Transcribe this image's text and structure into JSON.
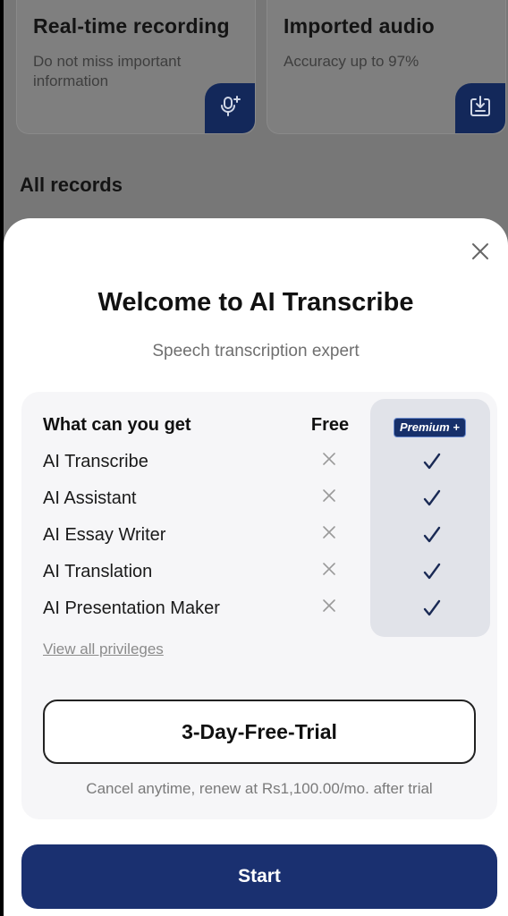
{
  "background": {
    "cards": [
      {
        "title": "Real-time recording",
        "subtitle": "Do not miss important information",
        "icon": "microphone-add-icon"
      },
      {
        "title": "Imported audio",
        "subtitle": "Accuracy up to 97%",
        "icon": "import-icon"
      }
    ],
    "records_title": "All records"
  },
  "sheet": {
    "title": "Welcome to AI Transcribe",
    "subtitle": "Speech transcription expert",
    "table": {
      "header_feature": "What can you get",
      "header_free": "Free",
      "header_premium": "Premium +",
      "rows": [
        {
          "feature": "AI Transcribe",
          "free": "cross-icon",
          "premium": "check-icon"
        },
        {
          "feature": "AI Assistant",
          "free": "cross-icon",
          "premium": "check-icon"
        },
        {
          "feature": "AI Essay Writer",
          "free": "cross-icon",
          "premium": "check-icon"
        },
        {
          "feature": "AI Translation",
          "free": "cross-icon",
          "premium": "check-icon"
        },
        {
          "feature": "AI Presentation Maker",
          "free": "cross-icon",
          "premium": "check-icon"
        }
      ]
    },
    "view_all_label": "View all privileges",
    "trial_label": "3-Day-Free-Trial",
    "cancel_text": "Cancel anytime, renew at Rs1,100.00/mo. after trial",
    "start_label": "Start"
  },
  "colors": {
    "primary": "#1a3070",
    "badge": "#17306a",
    "overlay": "#777777"
  }
}
